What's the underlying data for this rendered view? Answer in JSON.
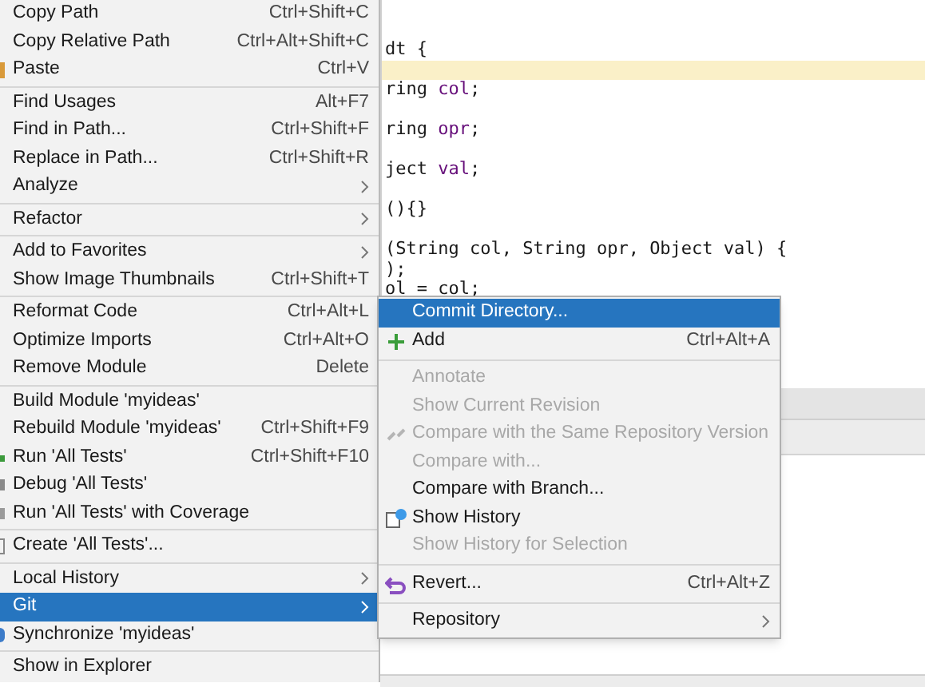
{
  "context_menu": {
    "items": [
      {
        "kind": "item",
        "label": "Copy Path",
        "shortcut": "Ctrl+Shift+C",
        "selected": false
      },
      {
        "kind": "item",
        "label": "Copy Relative Path",
        "shortcut": "Ctrl+Alt+Shift+C",
        "selected": false
      },
      {
        "kind": "item",
        "label": "Paste",
        "shortcut": "Ctrl+V",
        "selected": false
      },
      {
        "kind": "separator"
      },
      {
        "kind": "item",
        "label": "Find Usages",
        "shortcut": "Alt+F7",
        "selected": false
      },
      {
        "kind": "item",
        "label": "Find in Path...",
        "shortcut": "Ctrl+Shift+F",
        "selected": false
      },
      {
        "kind": "item",
        "label": "Replace in Path...",
        "shortcut": "Ctrl+Shift+R",
        "selected": false
      },
      {
        "kind": "submenu",
        "label": "Analyze",
        "selected": false
      },
      {
        "kind": "separator"
      },
      {
        "kind": "submenu",
        "label": "Refactor",
        "selected": false
      },
      {
        "kind": "separator"
      },
      {
        "kind": "submenu",
        "label": "Add to Favorites",
        "selected": false
      },
      {
        "kind": "item",
        "label": "Show Image Thumbnails",
        "shortcut": "Ctrl+Shift+T",
        "selected": false
      },
      {
        "kind": "separator"
      },
      {
        "kind": "item",
        "label": "Reformat Code",
        "shortcut": "Ctrl+Alt+L",
        "selected": false
      },
      {
        "kind": "item",
        "label": "Optimize Imports",
        "shortcut": "Ctrl+Alt+O",
        "selected": false
      },
      {
        "kind": "item",
        "label": "Remove Module",
        "shortcut": "Delete",
        "selected": false
      },
      {
        "kind": "separator"
      },
      {
        "kind": "item",
        "label": "Build Module 'myideas'",
        "selected": false
      },
      {
        "kind": "item",
        "label": "Rebuild Module 'myideas'",
        "shortcut": "Ctrl+Shift+F9",
        "selected": false
      },
      {
        "kind": "item",
        "label": "Run 'All Tests'",
        "shortcut": "Ctrl+Shift+F10",
        "selected": false
      },
      {
        "kind": "item",
        "label": "Debug 'All Tests'",
        "selected": false
      },
      {
        "kind": "item",
        "label": "Run 'All Tests' with Coverage",
        "selected": false
      },
      {
        "kind": "separator"
      },
      {
        "kind": "item",
        "label": "Create 'All Tests'...",
        "selected": false
      },
      {
        "kind": "separator"
      },
      {
        "kind": "submenu",
        "label": "Local History",
        "selected": false
      },
      {
        "kind": "submenu",
        "label": "Git",
        "selected": true
      },
      {
        "kind": "item",
        "label": "Synchronize 'myideas'",
        "selected": false
      },
      {
        "kind": "separator"
      },
      {
        "kind": "item",
        "label": "Show in Explorer",
        "selected": false
      }
    ]
  },
  "git_submenu": {
    "items": [
      {
        "kind": "item",
        "label": "Commit Directory...",
        "selected": true,
        "disabled": false
      },
      {
        "kind": "item",
        "label": "Add",
        "shortcut": "Ctrl+Alt+A",
        "selected": false,
        "disabled": false
      },
      {
        "kind": "separator"
      },
      {
        "kind": "item",
        "label": "Annotate",
        "selected": false,
        "disabled": true
      },
      {
        "kind": "item",
        "label": "Show Current Revision",
        "selected": false,
        "disabled": true
      },
      {
        "kind": "item",
        "label": "Compare with the Same Repository Version",
        "selected": false,
        "disabled": true
      },
      {
        "kind": "item",
        "label": "Compare with...",
        "selected": false,
        "disabled": true
      },
      {
        "kind": "item",
        "label": "Compare with Branch...",
        "selected": false,
        "disabled": false
      },
      {
        "kind": "item",
        "label": "Show History",
        "selected": false,
        "disabled": false
      },
      {
        "kind": "item",
        "label": "Show History for Selection",
        "selected": false,
        "disabled": true
      },
      {
        "kind": "separator"
      },
      {
        "kind": "item",
        "label": "Revert...",
        "shortcut": "Ctrl+Alt+Z",
        "selected": false,
        "disabled": false
      },
      {
        "kind": "separator"
      },
      {
        "kind": "submenu",
        "label": "Repository",
        "selected": false,
        "disabled": false
      }
    ]
  },
  "editor": {
    "lines": [
      {
        "highlighted": false
      },
      {
        "highlighted": false
      },
      {
        "highlighted": false,
        "segments": [
          {
            "kind": "plain",
            "text": "dt {"
          }
        ]
      },
      {
        "highlighted": true
      },
      {
        "highlighted": false,
        "segments": [
          {
            "kind": "plain",
            "text": "ring "
          },
          {
            "kind": "field",
            "text": "col"
          },
          {
            "kind": "plain",
            "text": ";"
          }
        ]
      },
      {
        "highlighted": false
      },
      {
        "highlighted": false,
        "segments": [
          {
            "kind": "plain",
            "text": "ring "
          },
          {
            "kind": "field",
            "text": "opr"
          },
          {
            "kind": "plain",
            "text": ";"
          }
        ]
      },
      {
        "highlighted": false
      },
      {
        "highlighted": false,
        "segments": [
          {
            "kind": "plain",
            "text": "ject "
          },
          {
            "kind": "field",
            "text": "val"
          },
          {
            "kind": "plain",
            "text": ";"
          }
        ]
      },
      {
        "highlighted": false
      },
      {
        "highlighted": false,
        "segments": [
          {
            "kind": "plain",
            "text": "(){}"
          }
        ]
      },
      {
        "highlighted": false
      },
      {
        "highlighted": false,
        "segments": [
          {
            "kind": "plain",
            "text": "(String col, String opr, Object val) {"
          }
        ]
      },
      {
        "highlighted": false,
        "segments": [
          {
            "kind": "plain",
            "text": ");"
          }
        ]
      },
      {
        "highlighted": false,
        "segments": [
          {
            "kind": "plain",
            "text": "ol = col;"
          }
        ]
      }
    ]
  }
}
